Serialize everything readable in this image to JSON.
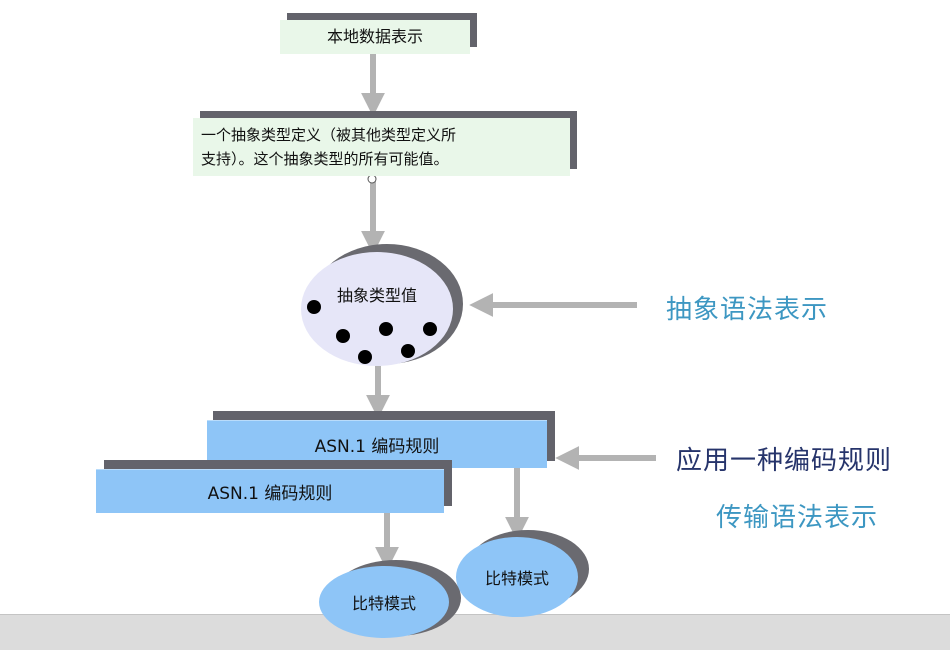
{
  "nodes": {
    "local": "本地数据表示",
    "abstract_type_line1": "一个抽象类型定义（被其他类型定义所",
    "abstract_type_line2": "支持）。这个抽象类型的所有可能值。",
    "abstract_values": "抽象类型值",
    "encoding_rule_1": "ASN.1  编码规则",
    "encoding_rule_2": "ASN.1  编码规则",
    "bit_pattern_1": "比特模式",
    "bit_pattern_2": "比特模式"
  },
  "labels": {
    "abstract_syntax": "抽象语法表示",
    "apply_encoding": "应用一种编码规则",
    "transfer_syntax": "传输语法表示"
  },
  "colors": {
    "box_green": "#e9f7e9",
    "box_blue": "#8ec5f7",
    "ellipse_lavender": "#e6e6f8",
    "shadow": "#63636b",
    "arrow": "#b3b3b3",
    "label_teal": "#3d97c2",
    "label_navy": "#26346b"
  }
}
